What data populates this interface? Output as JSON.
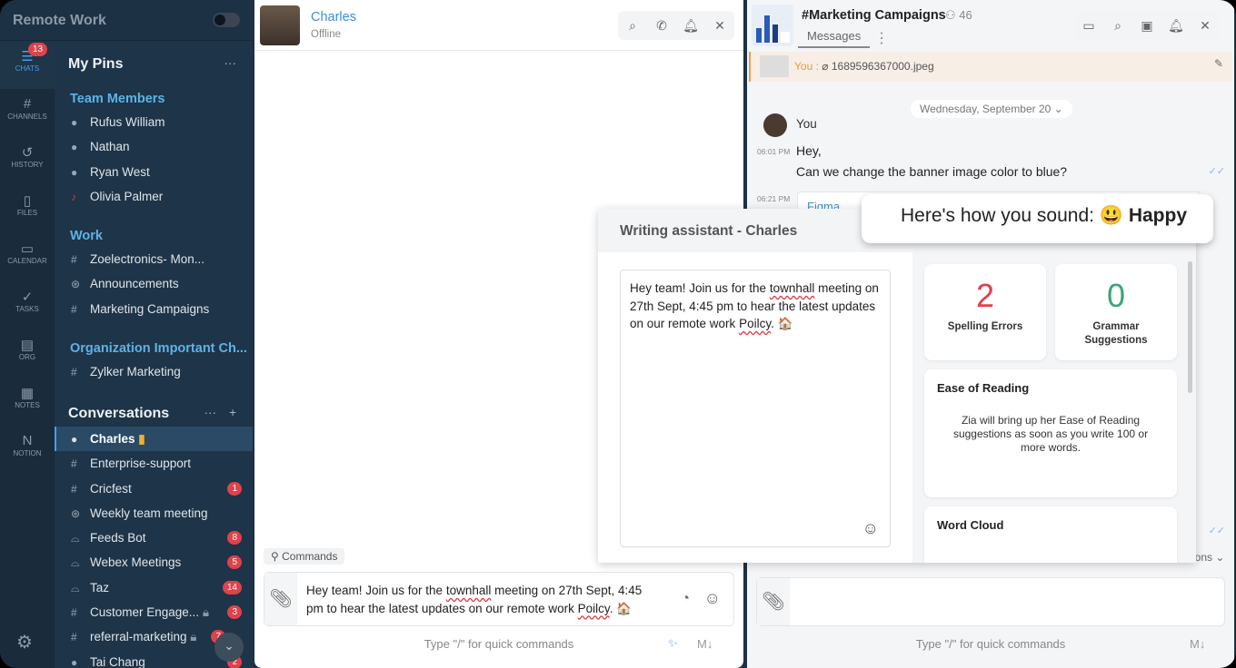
{
  "workspace": {
    "name": "Remote Work"
  },
  "rail": [
    {
      "label": "CHATS",
      "icon": "chat-icon",
      "badge": "13"
    },
    {
      "label": "CHANNELS",
      "icon": "hash-icon"
    },
    {
      "label": "HISTORY",
      "icon": "history-icon"
    },
    {
      "label": "FILES",
      "icon": "file-icon"
    },
    {
      "label": "CALENDAR",
      "icon": "calendar-icon"
    },
    {
      "label": "TASKS",
      "icon": "tasks-icon"
    },
    {
      "label": "ORG",
      "icon": "org-icon"
    },
    {
      "label": "NOTES",
      "icon": "notes-icon"
    },
    {
      "label": "NOTION",
      "icon": "notion-icon"
    }
  ],
  "pins": {
    "title": "My Pins",
    "team_title": "Team Members",
    "team": [
      "Rufus William",
      "Nathan",
      "Ryan West",
      "Olivia Palmer"
    ],
    "work_title": "Work",
    "work": [
      "Zoelectronics- Mon...",
      "Announcements",
      "Marketing Campaigns"
    ],
    "org_title": "Organization Important Ch...",
    "org": [
      "Zylker Marketing"
    ]
  },
  "conversations": {
    "title": "Conversations",
    "items": [
      {
        "name": "Charles",
        "badge": ""
      },
      {
        "name": "Enterprise-support",
        "badge": ""
      },
      {
        "name": "Cricfest",
        "badge": "1"
      },
      {
        "name": "Weekly team meeting",
        "badge": ""
      },
      {
        "name": "Feeds Bot",
        "badge": "8"
      },
      {
        "name": "Webex Meetings",
        "badge": "5"
      },
      {
        "name": "Taz",
        "badge": "14"
      },
      {
        "name": "Customer Engage...",
        "badge": "3"
      },
      {
        "name": "referral-marketing",
        "badge": "7"
      },
      {
        "name": "Tai Chang",
        "badge": "2"
      }
    ]
  },
  "chat": {
    "name": "Charles",
    "status": "Offline",
    "commands": "Commands",
    "draft_a": "Hey team! Join us for the ",
    "draft_b": "townhall",
    "draft_c": " meeting on 27th Sept, 4:45 pm to hear the latest updates on our remote work ",
    "draft_d": "Poilcy",
    "draft_e": ". 🏠",
    "hint": "Type \"/\" for quick commands",
    "md": "M↓"
  },
  "channel": {
    "name": "#Marketing Campaigns",
    "members": "46",
    "tab": "Messages",
    "pin_you": "You :",
    "pin_file": "1689596367000.jpeg",
    "date": "Wednesday, September 20",
    "sender": "You",
    "t1": "06:01 PM",
    "m1": "Hey,",
    "m2": "Can we change the banner image color to blue?",
    "t2": "06:21 PM",
    "m3": "Figma",
    "options": "ions",
    "hint": "Type \"/\" for quick commands",
    "md": "M↓"
  },
  "assistant": {
    "title": "Writing assistant - Charles",
    "spelling_count": "2",
    "spelling_label": "Spelling Errors",
    "grammar_count": "0",
    "grammar_label": "Grammar Suggestions",
    "ease_title": "Ease of Reading",
    "ease_text": "Zia will bring up her Ease of Reading suggestions as soon as you write 100 or more words.",
    "cloud_title": "Word Cloud"
  },
  "tone": {
    "prefix": "Here's how you sound:",
    "emoji": "😃",
    "label": "Happy"
  },
  "colors": {
    "accent": "#4a9ee8",
    "error": "#e0424b",
    "success": "#3aa57a"
  }
}
